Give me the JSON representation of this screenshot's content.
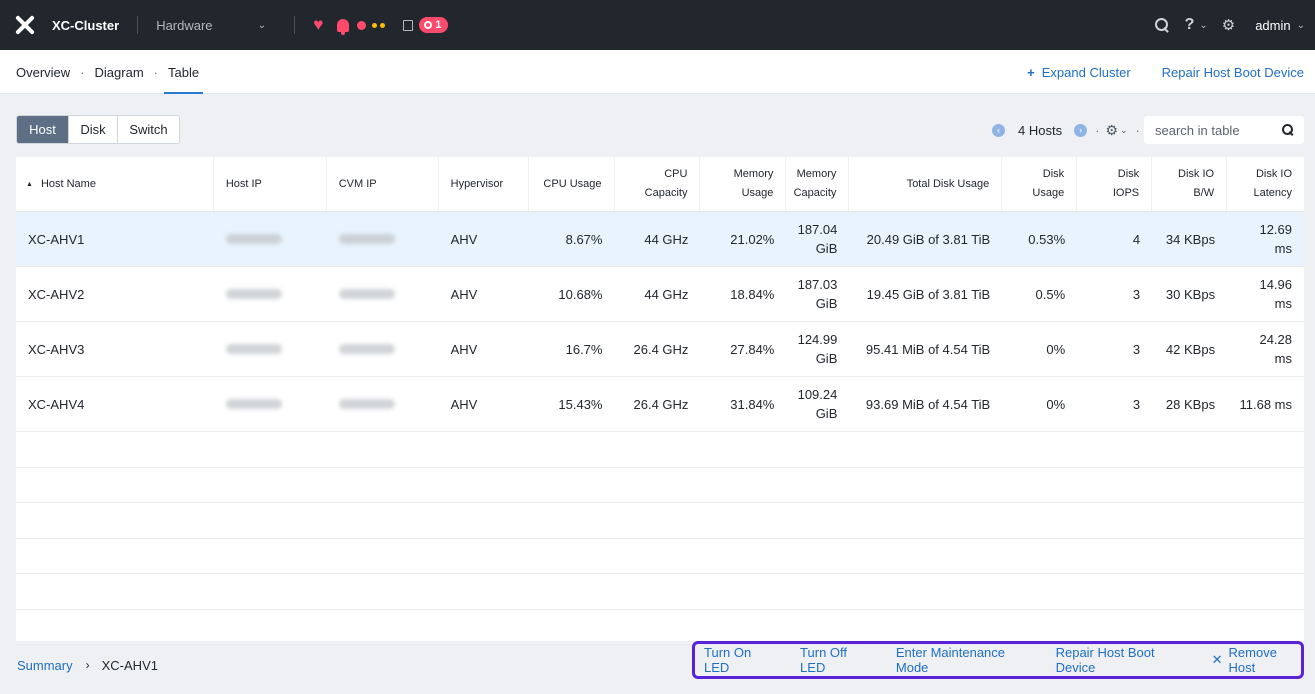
{
  "header": {
    "cluster_name": "XC-Cluster",
    "nav_select": "Hardware",
    "task_count": "1",
    "help_label": "?",
    "user": "admin"
  },
  "subnav": {
    "tabs": [
      {
        "label": "Overview"
      },
      {
        "label": "Diagram"
      },
      {
        "label": "Table"
      }
    ],
    "active_tab": "Table",
    "expand_cluster": "Expand Cluster",
    "repair_boot": "Repair Host Boot Device"
  },
  "toolbar": {
    "segments": [
      "Host",
      "Disk",
      "Switch"
    ],
    "active_segment": "Host",
    "host_count": "4 Hosts",
    "search_placeholder": "search in table"
  },
  "table": {
    "columns": [
      "Host Name",
      "Host IP",
      "CVM IP",
      "Hypervisor",
      "CPU Usage",
      "CPU Capacity",
      "Memory Usage",
      "Memory Capacity",
      "Total Disk Usage",
      "Disk Usage",
      "Disk IOPS",
      "Disk IO B/W",
      "Disk IO Latency"
    ],
    "sort_column": "Host Name",
    "rows": [
      {
        "name": "XC-AHV1",
        "hypervisor": "AHV",
        "cpu_usage": "8.67%",
        "cpu_capacity": "44 GHz",
        "mem_usage": "21.02%",
        "mem_capacity": "187.04 GiB",
        "total_disk": "20.49 GiB of 3.81 TiB",
        "disk_usage": "0.53%",
        "iops": "4",
        "bw": "34 KBps",
        "latency": "12.69 ms"
      },
      {
        "name": "XC-AHV2",
        "hypervisor": "AHV",
        "cpu_usage": "10.68%",
        "cpu_capacity": "44 GHz",
        "mem_usage": "18.84%",
        "mem_capacity": "187.03 GiB",
        "total_disk": "19.45 GiB of 3.81 TiB",
        "disk_usage": "0.5%",
        "iops": "3",
        "bw": "30 KBps",
        "latency": "14.96 ms"
      },
      {
        "name": "XC-AHV3",
        "hypervisor": "AHV",
        "cpu_usage": "16.7%",
        "cpu_capacity": "26.4 GHz",
        "mem_usage": "27.84%",
        "mem_capacity": "124.99 GiB",
        "total_disk": "95.41 MiB of 4.54 TiB",
        "disk_usage": "0%",
        "iops": "3",
        "bw": "42 KBps",
        "latency": "24.28 ms"
      },
      {
        "name": "XC-AHV4",
        "hypervisor": "AHV",
        "cpu_usage": "15.43%",
        "cpu_capacity": "26.4 GHz",
        "mem_usage": "31.84%",
        "mem_capacity": "109.24 GiB",
        "total_disk": "93.69 MiB of 4.54 TiB",
        "disk_usage": "0%",
        "iops": "3",
        "bw": "28 KBps",
        "latency": "11.68 ms"
      }
    ],
    "selected_row": "XC-AHV1"
  },
  "footer": {
    "breadcrumb_root": "Summary",
    "breadcrumb_current": "XC-AHV1",
    "actions": {
      "led_on": "Turn On LED",
      "led_off": "Turn Off LED",
      "maintenance": "Enter Maintenance Mode",
      "repair": "Repair Host Boot Device",
      "remove": "Remove Host"
    }
  },
  "colors": {
    "topbar": "#22272e",
    "accent": "#1f6fc5",
    "alert": "#ff4a6b",
    "selected_row": "#e8f3fd",
    "highlight_box": "#5a22d8"
  },
  "icons": [
    "logo-icon",
    "chevron-down-icon",
    "health-heart-icon",
    "alert-bell-icon",
    "task-icon",
    "search-icon",
    "help-icon",
    "gear-icon",
    "plus-icon",
    "prev-page-icon",
    "next-page-icon",
    "close-icon"
  ]
}
